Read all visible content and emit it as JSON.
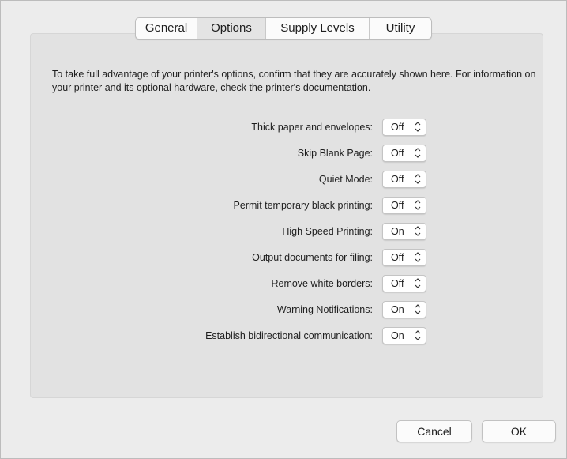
{
  "tabs": [
    {
      "label": "General"
    },
    {
      "label": "Options",
      "active": true
    },
    {
      "label": "Supply Levels"
    },
    {
      "label": "Utility"
    }
  ],
  "intro_text": "To take full advantage of your printer's options, confirm that they are accurately shown here. For information on your printer and its optional hardware, check the printer's documentation.",
  "options": [
    {
      "label": "Thick paper and envelopes:",
      "value": "Off"
    },
    {
      "label": "Skip Blank Page:",
      "value": "Off"
    },
    {
      "label": "Quiet Mode:",
      "value": "Off"
    },
    {
      "label": "Permit temporary black printing:",
      "value": "Off"
    },
    {
      "label": "High Speed Printing:",
      "value": "On"
    },
    {
      "label": "Output documents for filing:",
      "value": "Off"
    },
    {
      "label": "Remove white borders:",
      "value": "Off"
    },
    {
      "label": "Warning Notifications:",
      "value": "On"
    },
    {
      "label": "Establish bidirectional communication:",
      "value": "On"
    }
  ],
  "buttons": {
    "cancel_label": "Cancel",
    "ok_label": "OK"
  },
  "icons": {
    "select_stepper": "up-down-chevron-icon"
  }
}
